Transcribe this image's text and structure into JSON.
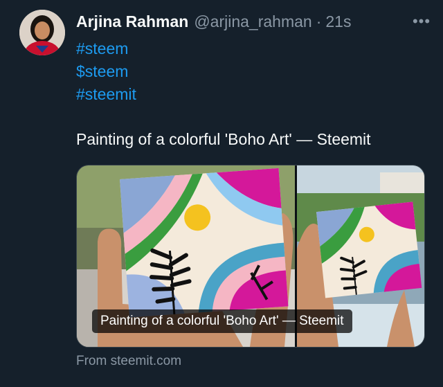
{
  "author": {
    "name": "Arjina Rahman",
    "handle": "@arjina_rahman",
    "separator": "·",
    "time": "21s"
  },
  "more_icon": "more-horizontal-icon",
  "more_label": "•••",
  "hashtags": [
    "#steem",
    "$steem",
    "#steemit"
  ],
  "text": "Painting of a colorful 'Boho Art' — Steemit",
  "card": {
    "caption": "Painting of a colorful 'Boho Art' — Steemit",
    "source": "From steemit.com"
  },
  "colors": {
    "background": "#15202b",
    "link": "#1d9bf0",
    "muted": "#8b98a5",
    "text": "#f7f9f9"
  }
}
